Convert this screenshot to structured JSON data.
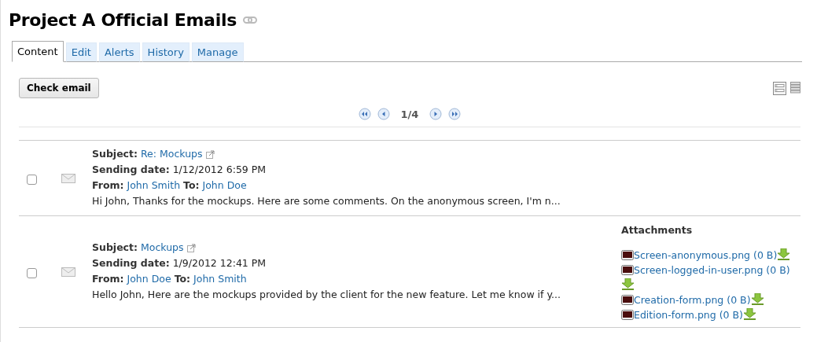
{
  "title": "Project A Official Emails",
  "tabs": [
    {
      "label": "Content",
      "selected": true
    },
    {
      "label": "Edit",
      "selected": false
    },
    {
      "label": "Alerts",
      "selected": false
    },
    {
      "label": "History",
      "selected": false
    },
    {
      "label": "Manage",
      "selected": false
    }
  ],
  "check_button": "Check email",
  "pager": {
    "page": "1/4"
  },
  "emails": [
    {
      "checked": false,
      "subject_label": "Subject:",
      "subject": "Re: Mockups",
      "date_label": "Sending date:",
      "date": "1/12/2012 6:59 PM",
      "from_label": "From:",
      "from": "John Smith",
      "to_label": "To:",
      "to": "John Doe",
      "summary": "Hi John, Thanks for the mockups. Here are some comments. On the anonymous screen, I'm n..."
    },
    {
      "checked": false,
      "subject_label": "Subject:",
      "subject": "Mockups",
      "date_label": "Sending date:",
      "date": "1/9/2012 12:41 PM",
      "from_label": "From:",
      "from": "John Doe",
      "to_label": "To:",
      "to": "John Smith",
      "summary": "Hello John, Here are the mockups provided by the client for the new feature. Let me know if y...",
      "attachments_title": "Attachments",
      "attachments": [
        "Screen-anonymous.png (0 B)",
        "Screen-logged-in-user.png (0 B)",
        "Creation-form.png (0 B)",
        "Edition-form.png (0 B)"
      ]
    }
  ]
}
